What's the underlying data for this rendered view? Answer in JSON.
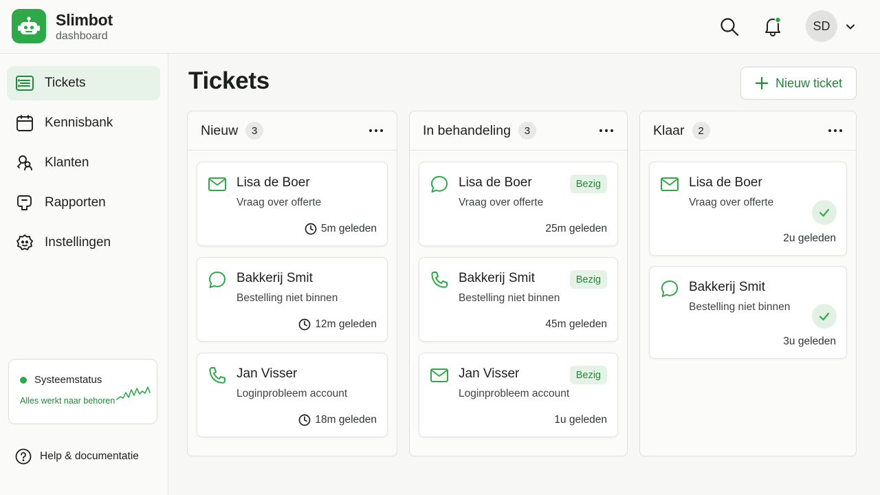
{
  "brand": {
    "title": "Slimbot",
    "subtitle": "dashboard"
  },
  "colors": {
    "accent": "#2fa84a",
    "accent_dark": "#23873a",
    "badge_bg": "#e5f2e6"
  },
  "header": {
    "avatar_initials": "SD",
    "has_notification": true
  },
  "sidebar": {
    "items": [
      {
        "label": "Tickets",
        "icon": "tickets-icon",
        "active": true
      },
      {
        "label": "Kennisbank",
        "icon": "calendar-icon",
        "active": false
      },
      {
        "label": "Klanten",
        "icon": "people-icon",
        "active": false
      },
      {
        "label": "Rapporten",
        "icon": "reports-icon",
        "active": false
      },
      {
        "label": "Instellingen",
        "icon": "settings-icon",
        "active": false
      }
    ],
    "status": {
      "title": "Systeemstatus",
      "text": "Alles werkt naar behoren"
    },
    "help": "Help & documentatie"
  },
  "main": {
    "title": "Tickets",
    "new_button": "Nieuw ticket",
    "columns": [
      {
        "title": "Nieuw",
        "count": "3",
        "cards": [
          {
            "channel": "mail-icon",
            "name": "Lisa de Boer",
            "subject": "Vraag over offerte",
            "time": "5m geleden"
          },
          {
            "channel": "chat-icon",
            "name": "Bakkerij Smit",
            "subject": "Bestelling niet binnen",
            "time": "12m geleden"
          },
          {
            "channel": "phone-icon",
            "name": "Jan Visser",
            "subject": "Loginprobleem account",
            "time": "18m geleden"
          }
        ]
      },
      {
        "title": "In behandeling",
        "count": "3",
        "cards": [
          {
            "channel": "chat-icon",
            "name": "Lisa de Boer",
            "subject": "Vraag over offerte",
            "time": "25m geleden",
            "badge": "Bezig"
          },
          {
            "channel": "phone-icon",
            "name": "Bakkerij Smit",
            "subject": "Bestelling niet binnen",
            "time": "45m geleden",
            "badge": "Bezig"
          },
          {
            "channel": "mail-icon",
            "name": "Jan Visser",
            "subject": "Loginprobleem account",
            "time": "1u geleden",
            "badge": "Bezig"
          }
        ]
      },
      {
        "title": "Klaar",
        "count": "2",
        "cards": [
          {
            "channel": "mail-icon",
            "name": "Lisa de Boer",
            "subject": "Vraag over offerte",
            "time": "2u geleden",
            "done": true
          },
          {
            "channel": "chat-icon",
            "name": "Bakkerij Smit",
            "subject": "Bestelling niet binnen",
            "time": "3u geleden",
            "done": true
          }
        ]
      }
    ]
  }
}
